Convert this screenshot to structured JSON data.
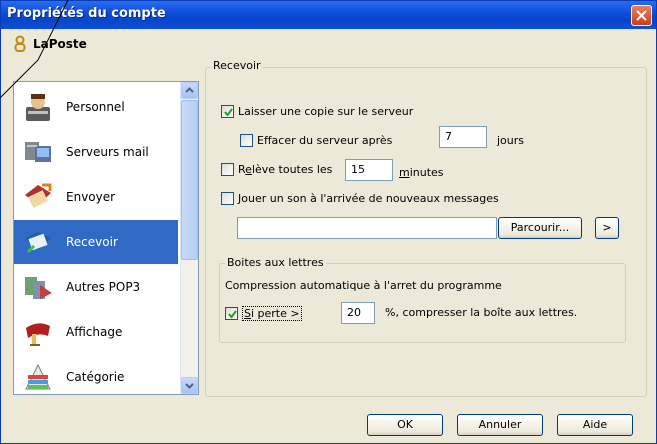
{
  "window": {
    "title": "Propriétés du compte"
  },
  "account": {
    "name": "LaPoste"
  },
  "sidebar": {
    "items": [
      {
        "label": "Personnel",
        "icon": "person-icon"
      },
      {
        "label": "Serveurs mail",
        "icon": "mail-servers-icon"
      },
      {
        "label": "Envoyer",
        "icon": "send-icon"
      },
      {
        "label": "Recevoir",
        "icon": "receive-icon",
        "selected": true
      },
      {
        "label": "Autres POP3",
        "icon": "other-pop3-icon"
      },
      {
        "label": "Affichage",
        "icon": "display-icon"
      },
      {
        "label": "Catégorie",
        "icon": "category-icon"
      }
    ]
  },
  "receive": {
    "legend": "Recevoir",
    "keep_copy": {
      "label": "Laisser une copie sur le serveur",
      "checked": true
    },
    "delete_after": {
      "label": "Effacer du serveur après",
      "checked": false,
      "value": "7",
      "unit": "jours"
    },
    "check_every": {
      "label_prefix": "R",
      "label_underlined": "e",
      "label_rest": "lève toutes les",
      "checked": false,
      "value": "15",
      "unit_underlined": "m",
      "unit_rest": "inutes"
    },
    "play_sound": {
      "label": "Jouer un son à l'arrivée de nouveaux messages",
      "checked": false,
      "value": ""
    },
    "browse_label": "Parcourir...",
    "play_label": ">"
  },
  "mailboxes": {
    "legend": "Boites aux lettres",
    "desc": "Compression automatique à l'arret du programme",
    "if_loss": {
      "label_underlined": "S",
      "label_rest": "i perte >",
      "checked": true,
      "value": "20",
      "suffix": "%, compresser la boîte aux lettres."
    }
  },
  "footer": {
    "ok": "OK",
    "cancel": "Annuler",
    "help": "Aide"
  },
  "colors": {
    "title_bar": "#0b4bd8",
    "selection": "#316ac5",
    "dialog_bg": "#ece9d8"
  }
}
